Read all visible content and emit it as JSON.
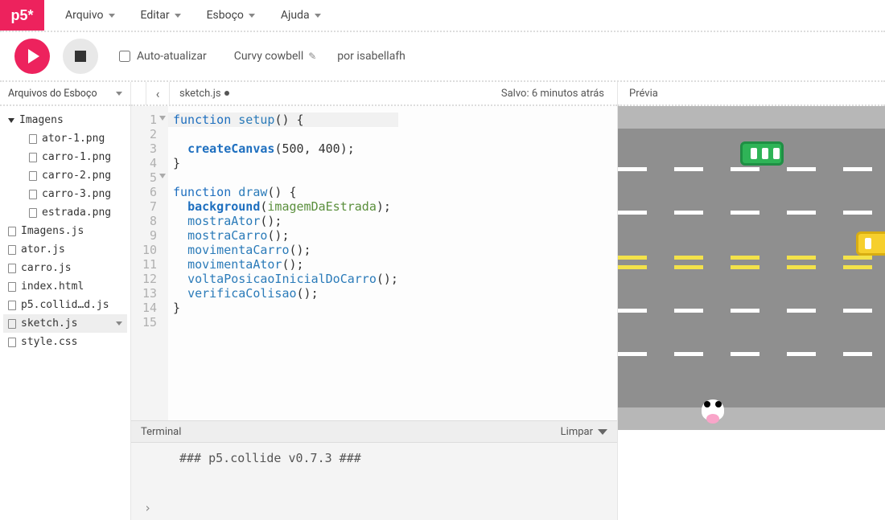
{
  "logo": "p5*",
  "menus": [
    "Arquivo",
    "Editar",
    "Esboço",
    "Ajuda"
  ],
  "toolbar": {
    "auto_refresh": "Auto-atualizar",
    "sketch_name": "Curvy cowbell",
    "author_prefix": "por ",
    "author": "isabellafh"
  },
  "sidebar": {
    "title": "Arquivos do Esboço",
    "folder": "Imagens",
    "folder_files": [
      "ator-1.png",
      "carro-1.png",
      "carro-2.png",
      "carro-3.png",
      "estrada.png"
    ],
    "root_files": [
      "Imagens.js",
      "ator.js",
      "carro.js",
      "index.html",
      "p5.collid…d.js",
      "sketch.js",
      "style.css"
    ],
    "active_file": "sketch.js"
  },
  "editor": {
    "filename": "sketch.js",
    "saved_status": "Salvo: 6 minutos atrás",
    "line_count": 15,
    "fold_lines": [
      1,
      5
    ]
  },
  "terminal": {
    "title": "Terminal",
    "clear": "Limpar",
    "line": "### p5.collide v0.7.3 ###"
  },
  "preview": {
    "title": "Prévia"
  }
}
